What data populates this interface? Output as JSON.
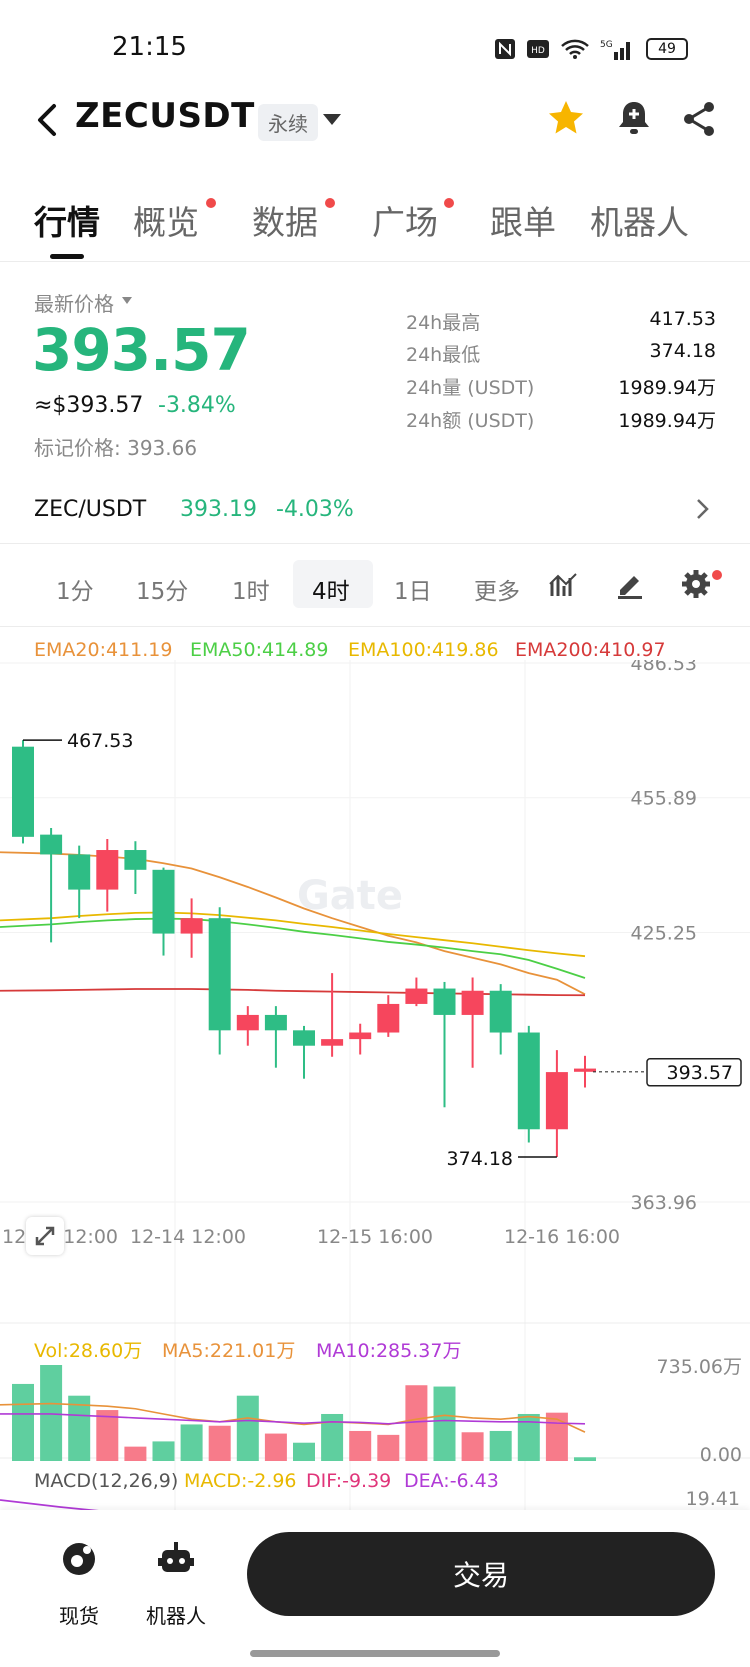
{
  "status_bar": {
    "time": "21:15",
    "battery": "49"
  },
  "header": {
    "symbol": "ZECUSDT",
    "contract_tag": "永续"
  },
  "tabs": [
    {
      "label": "行情",
      "active": true,
      "dot": false
    },
    {
      "label": "概览",
      "active": false,
      "dot": true
    },
    {
      "label": "数据",
      "active": false,
      "dot": true
    },
    {
      "label": "广场",
      "active": false,
      "dot": true
    },
    {
      "label": "跟单",
      "active": false,
      "dot": false
    },
    {
      "label": "机器人",
      "active": false,
      "dot": false
    }
  ],
  "price": {
    "latest_label": "最新价格",
    "last": "393.57",
    "usd": "≈$393.57",
    "change_pct": "-3.84%",
    "mark_label": "标记价格: 393.66"
  },
  "stats": [
    {
      "label": "24h最高",
      "value": "417.53"
    },
    {
      "label": "24h最低",
      "value": "374.18"
    },
    {
      "label": "24h量 (USDT)",
      "value": "1989.94万"
    },
    {
      "label": "24h额 (USDT)",
      "value": "1989.94万"
    }
  ],
  "spot": {
    "pair": "ZEC/USDT",
    "price": "393.19",
    "change": "-4.03%"
  },
  "intervals": [
    {
      "label": "1分",
      "active": false
    },
    {
      "label": "15分",
      "active": false
    },
    {
      "label": "1时",
      "active": false
    },
    {
      "label": "4时",
      "active": true
    },
    {
      "label": "1日",
      "active": false
    },
    {
      "label": "更多",
      "active": false
    }
  ],
  "ema_legend": [
    {
      "text": "EMA20:411.19",
      "color": "#e8923a"
    },
    {
      "text": "EMA50:414.89",
      "color": "#4ccf46"
    },
    {
      "text": "EMA100:419.86",
      "color": "#e8b800"
    },
    {
      "text": "EMA200:410.97",
      "color": "#d63a3a"
    }
  ],
  "chart_data": {
    "type": "candlestick",
    "y_axis_ticks": [
      "486.53",
      "455.89",
      "425.25",
      "363.96"
    ],
    "ylim": [
      363.96,
      486.53
    ],
    "x_ticks": [
      "12-13 12:00",
      "12-14 12:00",
      "12-15 16:00",
      "12-16 16:00"
    ],
    "high_marker": "467.53",
    "low_marker": "374.18",
    "current_price_tag": "393.57",
    "watermark": "Gate",
    "candles": [
      {
        "o": 447.0,
        "h": 469.0,
        "l": 445.5,
        "c": 467.5
      },
      {
        "o": 443.0,
        "h": 449.0,
        "l": 423.0,
        "c": 447.5
      },
      {
        "o": 435.0,
        "h": 445.0,
        "l": 428.5,
        "c": 443.0
      },
      {
        "o": 444.0,
        "h": 446.5,
        "l": 430.0,
        "c": 435.0
      },
      {
        "o": 439.5,
        "h": 446.0,
        "l": 434.0,
        "c": 444.0
      },
      {
        "o": 425.0,
        "h": 440.0,
        "l": 420.0,
        "c": 439.5
      },
      {
        "o": 428.5,
        "h": 433.0,
        "l": 419.5,
        "c": 425.0
      },
      {
        "o": 403.0,
        "h": 431.0,
        "l": 397.5,
        "c": 428.5
      },
      {
        "o": 406.5,
        "h": 408.5,
        "l": 399.5,
        "c": 403.0
      },
      {
        "o": 403.0,
        "h": 408.5,
        "l": 394.5,
        "c": 406.5
      },
      {
        "o": 399.5,
        "h": 404.0,
        "l": 392.0,
        "c": 403.0
      },
      {
        "o": 401.0,
        "h": 416.0,
        "l": 397.0,
        "c": 399.5
      },
      {
        "o": 402.5,
        "h": 404.5,
        "l": 397.5,
        "c": 401.0
      },
      {
        "o": 409.0,
        "h": 411.0,
        "l": 401.5,
        "c": 402.5
      },
      {
        "o": 412.5,
        "h": 415.0,
        "l": 408.5,
        "c": 409.0
      },
      {
        "o": 406.5,
        "h": 414.0,
        "l": 385.5,
        "c": 412.5
      },
      {
        "o": 412.0,
        "h": 415.0,
        "l": 394.5,
        "c": 406.5
      },
      {
        "o": 402.5,
        "h": 413.5,
        "l": 397.5,
        "c": 412.0
      },
      {
        "o": 380.5,
        "h": 404.0,
        "l": 377.5,
        "c": 402.5
      },
      {
        "o": 393.5,
        "h": 398.5,
        "l": 374.2,
        "c": 380.5
      },
      {
        "o": 394.3,
        "h": 397.2,
        "l": 390.0,
        "c": 393.57
      }
    ],
    "ema_series": [
      {
        "name": "EMA20",
        "color": "#e8923a",
        "values": [
          443.5,
          443.2,
          442.9,
          442.5,
          442.0,
          441.0,
          439.8,
          437.8,
          435.6,
          433.2,
          430.7,
          428.5,
          426.5,
          424.5,
          423.0,
          421.0,
          419.5,
          418.0,
          416.0,
          414.5,
          411.19
        ]
      },
      {
        "name": "EMA50",
        "color": "#4ccf46",
        "values": [
          426.5,
          427.1,
          427.6,
          428.0,
          428.3,
          428.4,
          428.3,
          427.8,
          427.1,
          426.3,
          425.4,
          424.7,
          423.9,
          423.1,
          422.5,
          421.8,
          421.0,
          420.3,
          419.0,
          417.0,
          414.89
        ]
      },
      {
        "name": "EMA100",
        "color": "#e8b800",
        "values": [
          428.0,
          428.5,
          429.0,
          429.4,
          429.7,
          429.8,
          429.6,
          429.2,
          428.6,
          428.0,
          427.2,
          426.5,
          425.7,
          424.9,
          424.2,
          423.5,
          422.8,
          422.0,
          421.2,
          420.5,
          419.86
        ]
      },
      {
        "name": "EMA200",
        "color": "#d63a3a",
        "values": [
          412.0,
          412.1,
          412.2,
          412.3,
          412.4,
          412.4,
          412.4,
          412.3,
          412.2,
          412.0,
          411.9,
          411.8,
          411.7,
          411.6,
          411.5,
          411.4,
          411.3,
          411.2,
          411.1,
          411.0,
          410.97
        ]
      }
    ]
  },
  "volume": {
    "legend": [
      {
        "text": "Vol:28.60万",
        "color": "#e8b800"
      },
      {
        "text": "MA5:221.01万",
        "color": "#e8923a"
      },
      {
        "text": "MA10:285.37万",
        "color": "#b03ad6"
      }
    ],
    "y_max_label": "735.06万",
    "y_min_label": "0.00",
    "bars": [
      {
        "v": 590,
        "up": true
      },
      {
        "v": 735,
        "up": true
      },
      {
        "v": 500,
        "up": true
      },
      {
        "v": 390,
        "up": false
      },
      {
        "v": 110,
        "up": false
      },
      {
        "v": 150,
        "up": true
      },
      {
        "v": 280,
        "up": true
      },
      {
        "v": 270,
        "up": false
      },
      {
        "v": 500,
        "up": true
      },
      {
        "v": 210,
        "up": false
      },
      {
        "v": 140,
        "up": true
      },
      {
        "v": 360,
        "up": true
      },
      {
        "v": 230,
        "up": false
      },
      {
        "v": 200,
        "up": false
      },
      {
        "v": 580,
        "up": false
      },
      {
        "v": 570,
        "up": true
      },
      {
        "v": 220,
        "up": false
      },
      {
        "v": 230,
        "up": true
      },
      {
        "v": 360,
        "up": true
      },
      {
        "v": 370,
        "up": false
      },
      {
        "v": 28.6,
        "up": true
      }
    ],
    "ma5": [
      430,
      440,
      430,
      420,
      400,
      360,
      320,
      300,
      330,
      300,
      280,
      300,
      290,
      280,
      320,
      350,
      330,
      320,
      340,
      320,
      221
    ],
    "ma10": [
      360,
      360,
      350,
      340,
      330,
      320,
      310,
      300,
      310,
      300,
      290,
      300,
      295,
      285,
      300,
      310,
      305,
      300,
      300,
      290,
      285
    ]
  },
  "macd": {
    "title": "MACD(12,26,9)",
    "macd": "MACD:-2.96",
    "dif": "DIF:-9.39",
    "dea": "DEA:-6.43",
    "y_label": "19.41"
  },
  "bottom_nav": {
    "spot": "现货",
    "bot": "机器人",
    "trade": "交易"
  }
}
